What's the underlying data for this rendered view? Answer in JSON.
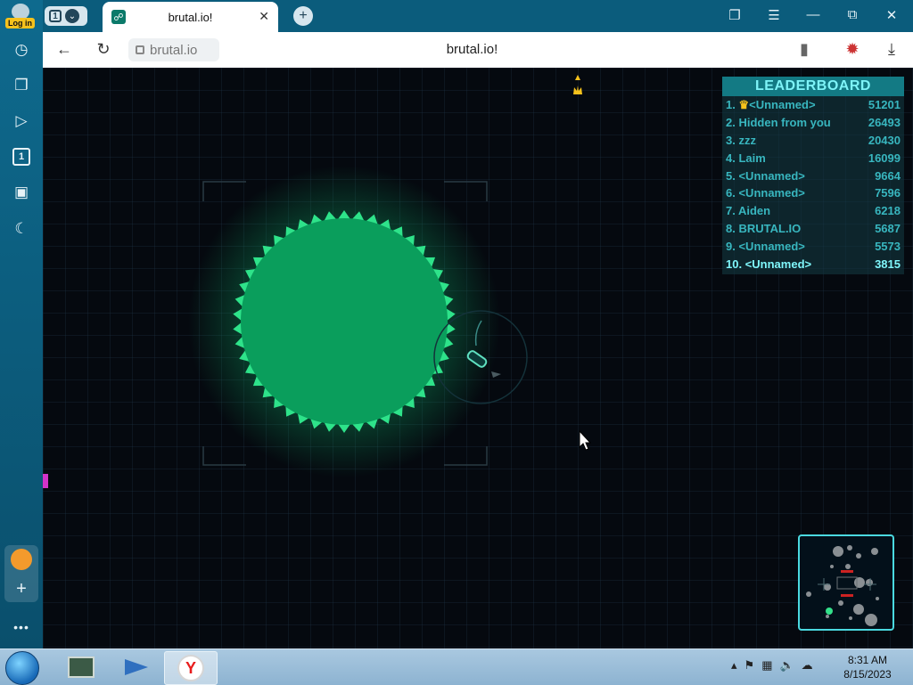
{
  "browser": {
    "login_label": "Log in",
    "tab_count": "1",
    "tab_title": "brutal.io!",
    "address_host": "brutal.io",
    "page_heading": "brutal.io!"
  },
  "sidebar": {
    "items": [
      "history-icon",
      "collections-icon",
      "video-icon",
      "tab-count-icon",
      "screenshot-icon",
      "night-mode-icon"
    ],
    "counter_label": "1"
  },
  "game": {
    "title": "LEADERBOARD",
    "leaderboard": [
      {
        "rank": "1.",
        "name": "<Unnamed>",
        "score": "51201",
        "crown": true
      },
      {
        "rank": "2.",
        "name": "Hidden from you",
        "score": "26493"
      },
      {
        "rank": "3.",
        "name": "zzz",
        "score": "20430"
      },
      {
        "rank": "4.",
        "name": "Laim",
        "score": "16099"
      },
      {
        "rank": "5.",
        "name": "<Unnamed>",
        "score": "9664"
      },
      {
        "rank": "6.",
        "name": "<Unnamed>",
        "score": "7596"
      },
      {
        "rank": "7.",
        "name": "Aiden",
        "score": "6218"
      },
      {
        "rank": "8.",
        "name": "BRUTAL.IO",
        "score": "5687"
      },
      {
        "rank": "9.",
        "name": "<Unnamed>",
        "score": "5573"
      },
      {
        "rank": "10.",
        "name": "<Unnamed>",
        "score": "3815",
        "is_player": true
      }
    ],
    "colors": {
      "blob_fill": "#0a9e5c",
      "blob_spikes": "#2ee38a",
      "background": "#05090f",
      "leaderboard_header": "#137a84",
      "leaderboard_text": "#38b6bf",
      "player_highlight": "#7ff6fb",
      "minimap_border": "#4ad9e0"
    }
  },
  "taskbar": {
    "time": "8:31 AM",
    "date": "8/15/2023",
    "apps": [
      "terminal-app",
      "jet-app",
      "yandex-browser"
    ]
  }
}
